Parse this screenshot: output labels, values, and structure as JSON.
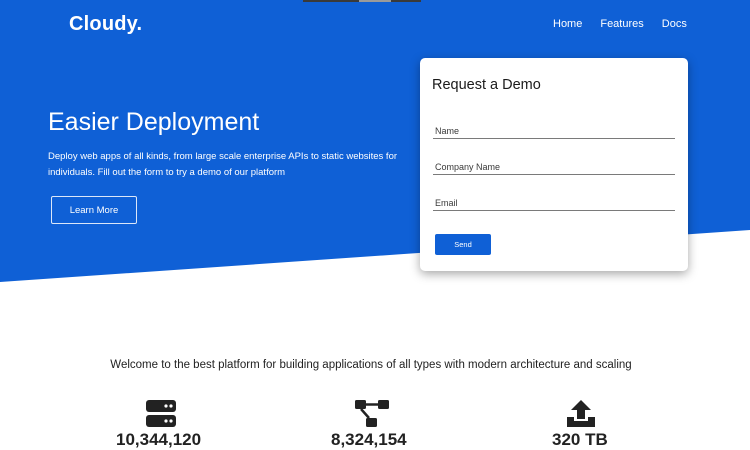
{
  "brand": {
    "name": "Cloudy.",
    "primary_color": "#0f60d6"
  },
  "nav": {
    "items": [
      "Home",
      "Features",
      "Docs"
    ]
  },
  "hero": {
    "title": "Easier Deployment",
    "description": "Deploy web apps of all kinds, from large scale enterprise APIs to static websites for individuals. Fill out the form to try a demo of our platform",
    "cta_label": "Learn More"
  },
  "demo_form": {
    "title": "Request a Demo",
    "name_placeholder": "Name",
    "company_placeholder": "Company Name",
    "email_placeholder": "Email",
    "submit_label": "Send"
  },
  "welcome": {
    "text": "Welcome to the best platform for building applications of all types with modern architecture and scaling"
  },
  "features": [
    {
      "icon": "server-icon",
      "stat": "10,344,120"
    },
    {
      "icon": "network-icon",
      "stat": "8,324,154"
    },
    {
      "icon": "upload-icon",
      "stat": "320 TB"
    }
  ]
}
